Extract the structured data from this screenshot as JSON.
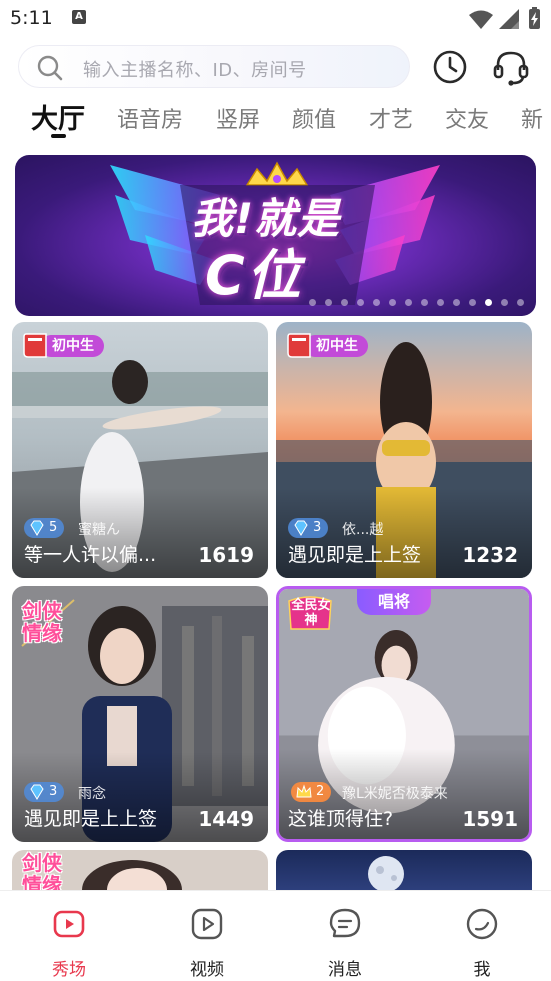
{
  "status_bar": {
    "time": "5:11",
    "notification_letter": "A"
  },
  "search": {
    "placeholder": "输入主播名称、ID、房间号"
  },
  "tabs": [
    {
      "label": "大厅",
      "active": true
    },
    {
      "label": "语音房"
    },
    {
      "label": "竖屏"
    },
    {
      "label": "颜值"
    },
    {
      "label": "才艺"
    },
    {
      "label": "交友"
    },
    {
      "label": "新"
    }
  ],
  "banner": {
    "title_line1": "我!就是",
    "title_line2": "C位",
    "slide_count": 14,
    "active_slide_index": 11
  },
  "cards": [
    {
      "badge": "初中生",
      "level": "5",
      "anchor": "蜜糖ん",
      "title": "等一人许以偏...",
      "count": "1619"
    },
    {
      "badge": "初中生",
      "level": "3",
      "anchor": "依...越",
      "title": "遇见即是上上签",
      "count": "1232"
    },
    {
      "badge": "剑侠情缘",
      "level": "3",
      "anchor": "雨念",
      "title": "遇见即是上上签",
      "count": "1449"
    },
    {
      "badge": "全民女神",
      "badge2": "唱将",
      "level": "2",
      "anchor": "豫L米妮否极泰来",
      "title": "这谁顶得住?",
      "count": "1591"
    },
    {
      "badge": "剑侠情缘"
    }
  ],
  "bottom_nav": [
    {
      "label": "秀场",
      "icon": "live-tv-icon",
      "active": true
    },
    {
      "label": "视频",
      "icon": "play-video-icon"
    },
    {
      "label": "消息",
      "icon": "message-bubble-icon"
    },
    {
      "label": "我",
      "icon": "profile-circle-icon"
    }
  ],
  "colors": {
    "accent": "#e8384d",
    "active_tab": "#111111",
    "inactive_tab": "#7a7a7a",
    "diamond": "#5ec3ff"
  }
}
